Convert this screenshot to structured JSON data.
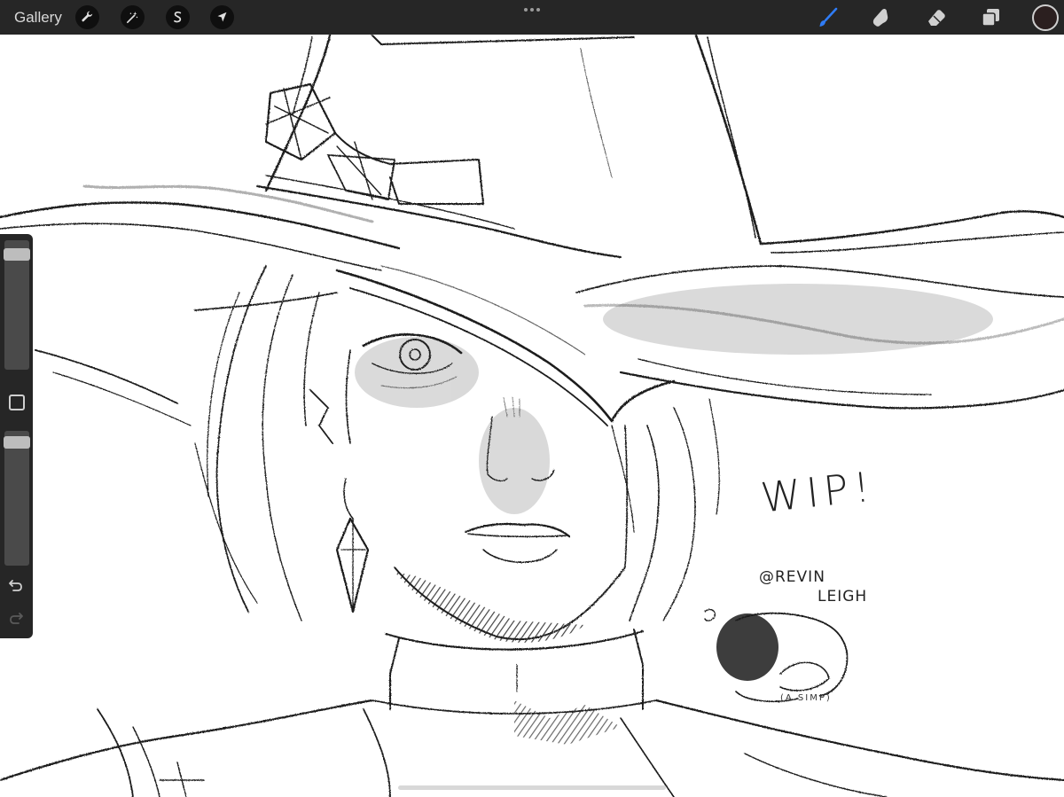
{
  "toolbar": {
    "gallery_label": "Gallery",
    "left_tools": [
      {
        "name": "actions",
        "icon": "wrench-icon"
      },
      {
        "name": "adjustments",
        "icon": "magic-wand-icon"
      },
      {
        "name": "selection",
        "icon": "selection-s-icon"
      },
      {
        "name": "transform",
        "icon": "arrow-cursor-icon"
      }
    ],
    "more_icon": "ellipsis-icon",
    "right_tools": [
      {
        "name": "brush",
        "icon": "brush-icon",
        "active": true
      },
      {
        "name": "smudge",
        "icon": "smudge-icon",
        "active": false
      },
      {
        "name": "eraser",
        "icon": "eraser-icon",
        "active": false
      },
      {
        "name": "layers",
        "icon": "layers-icon",
        "active": false
      }
    ],
    "active_color": "#2b1f1f",
    "accent_color": "#2f7cf6"
  },
  "sidebar": {
    "brush_size_level": 0.07,
    "opacity_level": 0.04,
    "modify_icon": "square-icon",
    "undo_icon": "undo-icon",
    "redo_icon": "redo-icon"
  },
  "canvas": {
    "wip": "WIP!",
    "credit_line1": "@REVIN",
    "credit_line2": "LEIGH",
    "caption": "(A SIMP)"
  }
}
